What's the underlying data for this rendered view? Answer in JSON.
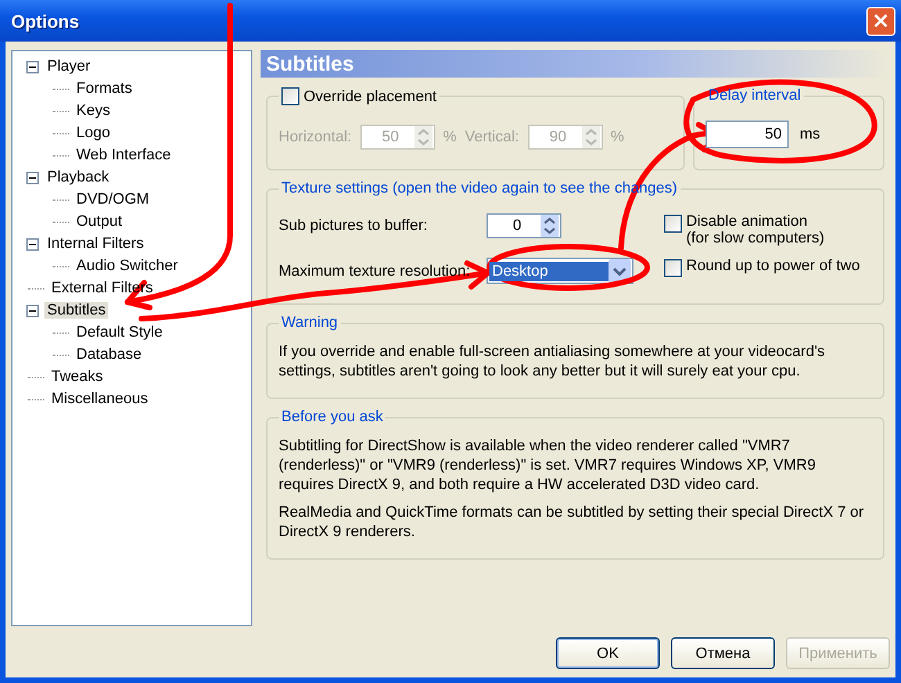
{
  "window": {
    "title": "Options",
    "close": "×"
  },
  "tree": [
    {
      "label": "Player",
      "expanded": true,
      "selected": false,
      "children": [
        {
          "label": "Formats",
          "selected": false
        },
        {
          "label": "Keys",
          "selected": false
        },
        {
          "label": "Logo",
          "selected": false
        },
        {
          "label": "Web Interface",
          "selected": false
        }
      ]
    },
    {
      "label": "Playback",
      "expanded": true,
      "selected": false,
      "children": [
        {
          "label": "DVD/OGM",
          "selected": false
        },
        {
          "label": "Output",
          "selected": false
        }
      ]
    },
    {
      "label": "Internal Filters",
      "expanded": true,
      "selected": false,
      "children": [
        {
          "label": "Audio Switcher",
          "selected": false
        }
      ]
    },
    {
      "label": "External Filters",
      "selected": false
    },
    {
      "label": "Subtitles",
      "expanded": true,
      "selected": true,
      "children": [
        {
          "label": "Default Style",
          "selected": false
        },
        {
          "label": "Database",
          "selected": false
        }
      ]
    },
    {
      "label": "Tweaks",
      "selected": false
    },
    {
      "label": "Miscellaneous",
      "selected": false
    }
  ],
  "page": {
    "title": "Subtitles",
    "override": {
      "label": "Override placement",
      "checked": false,
      "fields": [
        {
          "label": "Horizontal:",
          "value": "50",
          "unit": "%",
          "disabled": true
        },
        {
          "label": "Vertical:",
          "value": "90",
          "unit": "%",
          "disabled": true
        }
      ]
    },
    "delay": {
      "title": "Delay interval",
      "value": "50",
      "unit": "ms"
    },
    "texture": {
      "title": "Texture settings (open the video again to see the changes)",
      "buffer": {
        "label": "Sub pictures to buffer:",
        "value": "0"
      },
      "resolution": {
        "label": "Maximum texture resolution:",
        "value": "Desktop",
        "selected": true
      },
      "checks": [
        {
          "label": "Disable animation",
          "note": "(for slow computers)",
          "checked": false
        },
        {
          "label": "Round up to power of two",
          "checked": false
        }
      ]
    },
    "warning": {
      "title": "Warning",
      "text": "If you override and enable full-screen antialiasing somewhere at your videocard's settings, subtitles aren't going to look any better but it will surely eat your cpu."
    },
    "before": {
      "title": "Before you ask",
      "paragraphs": [
        "Subtitling for DirectShow is available when the video renderer called \"VMR7 (renderless)\" or \"VMR9 (renderless)\" is set. VMR7 requires Windows XP, VMR9 requires DirectX 9, and both require a HW accelerated D3D video card.",
        "RealMedia and QuickTime formats can be subtitled by setting their special DirectX 7 or DirectX 9 renderers."
      ]
    }
  },
  "buttons": [
    {
      "label": "OK",
      "disabled": false,
      "default": true
    },
    {
      "label": "Отмена",
      "disabled": false,
      "default": false
    },
    {
      "label": "Применить",
      "disabled": true,
      "default": false
    }
  ]
}
